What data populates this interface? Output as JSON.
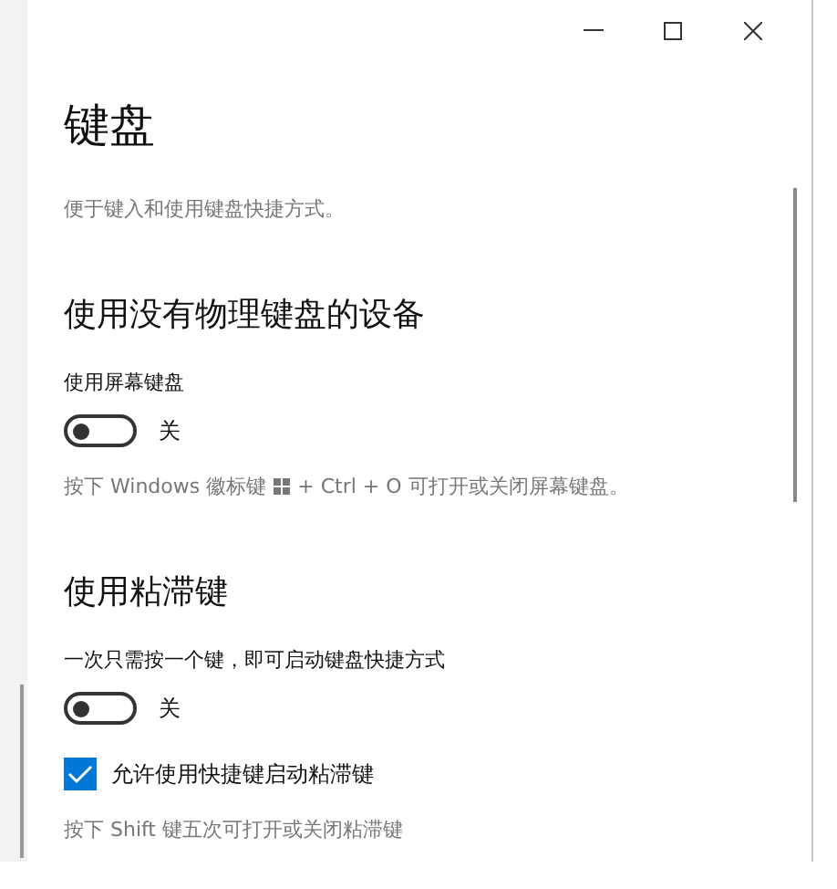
{
  "window": {
    "controls": [
      {
        "kind": "minimize"
      },
      {
        "kind": "maximize"
      },
      {
        "kind": "close"
      }
    ]
  },
  "title": "键盘",
  "description": "便于键入和使用键盘快捷方式。",
  "sections": [
    {
      "heading": "使用没有物理键盘的设备",
      "items": [
        {
          "kind": "toggle",
          "label": "使用屏幕键盘",
          "on": false,
          "state_text": "关"
        },
        {
          "kind": "hint",
          "text_before": "按下 Windows 徽标键",
          "text_after": "+ Ctrl + O 可打开或关闭屏幕键盘。"
        }
      ]
    },
    {
      "heading": "使用粘滞键",
      "items": [
        {
          "kind": "toggle",
          "label": "一次只需按一个键，即可启动键盘快捷方式",
          "on": false,
          "state_text": "关"
        },
        {
          "kind": "checkbox",
          "label": "允许使用快捷键启动粘滞键",
          "checked": true
        },
        {
          "kind": "hint",
          "text_before": "按下 Shift 键五次可打开或关闭粘滞键"
        }
      ]
    }
  ]
}
